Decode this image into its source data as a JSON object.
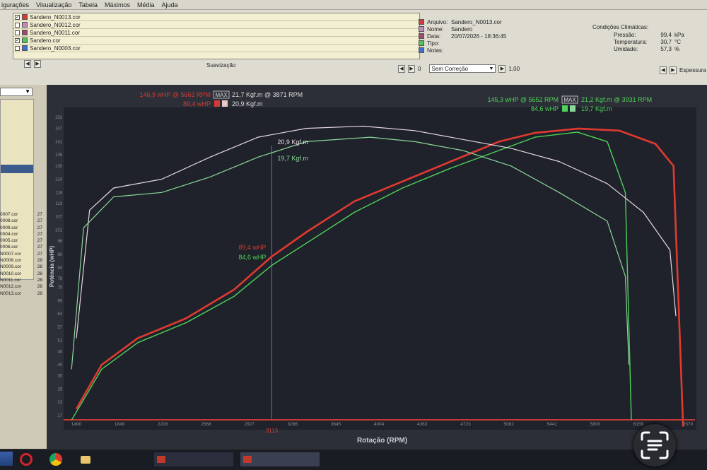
{
  "menu": {
    "items": [
      "igurações",
      "Visualização",
      "Tabela",
      "Máximos",
      "Média",
      "Ajuda"
    ]
  },
  "file_list": [
    {
      "name": "Sandero_N0013.cor",
      "checked": true,
      "color": "#d23a3a"
    },
    {
      "name": "Sandero_N0012.cor",
      "checked": false,
      "color": "#c18bbf"
    },
    {
      "name": "Sandero_N0011.cor",
      "checked": false,
      "color": "#a04a6a"
    },
    {
      "name": "Sandero.cor",
      "checked": true,
      "color": "#4fc25a"
    },
    {
      "name": "Sandero_N0003.cor",
      "checked": false,
      "color": "#3e6fd0"
    }
  ],
  "file_info": [
    {
      "label": "Arquivo:",
      "value": "Sandero_N0013.cor",
      "color": "#d23a3a"
    },
    {
      "label": "Nome:",
      "value": "Sandero",
      "color": "#c18bbf"
    },
    {
      "label": "Data:",
      "value": "20/07/2026 - 18:36:45",
      "color": "#a04a6a"
    },
    {
      "label": "Tipo:",
      "value": "",
      "color": "#4fc25a"
    },
    {
      "label": "Notas:",
      "value": "",
      "color": "#3e6fd0"
    }
  ],
  "climate": {
    "title": "Condições Climáticas:",
    "rows": [
      {
        "label": "Pressão:",
        "value": "99,4",
        "unit": "kPa"
      },
      {
        "label": "Temperatura:",
        "value": "30,7",
        "unit": "°C"
      },
      {
        "label": "Umidade:",
        "value": "57,3",
        "unit": "%"
      }
    ]
  },
  "controls": {
    "smoothing_label": "Suavização",
    "smoothing_value": "0",
    "correction_selected": "Sem Correção",
    "correction_factor": "1,00",
    "thickness_label": "Espessura"
  },
  "sidebar_files": [
    {
      "name": "0007.cor",
      "n": "27"
    },
    {
      "name": "0008.cor",
      "n": "27"
    },
    {
      "name": "0009.cor",
      "n": "27"
    },
    {
      "name": "0004.cor",
      "n": "27"
    },
    {
      "name": "0005.cor",
      "n": "27"
    },
    {
      "name": "0006.cor",
      "n": "27"
    },
    {
      "name": "N0007.cor",
      "n": "27"
    },
    {
      "name": "N0008.cor",
      "n": "28"
    },
    {
      "name": "N0009.cor",
      "n": "28"
    },
    {
      "name": "N0010.cor",
      "n": "28"
    },
    {
      "name": "N0011.cor",
      "n": "28"
    },
    {
      "name": "N0012.cor",
      "n": "28"
    },
    {
      "name": "N0013.cor",
      "n": "28"
    }
  ],
  "readouts": {
    "red_max": "146,9 wHP @ 5662 RPM",
    "red_max_badge": "MAX",
    "red_torque_max": "21,7 Kgf.m @ 3871 RPM",
    "red_cursor_power": "89,4 wHP",
    "red_cursor_torque": "20,9 Kgf.m",
    "green_max": "145,3 wHP @ 5652 RPM",
    "green_max_badge": "MAX",
    "green_torque_max": "21,2 Kgf.m @ 3931 RPM",
    "green_cursor_power": "84,6 wHP",
    "green_cursor_torque": "19,7 Kgf.m",
    "cursor_rpm": "3113"
  },
  "chart_data": {
    "type": "line",
    "xlabel": "Rotação (RPM)",
    "ylabel": "Potência (wHP)",
    "x_ticks": [
      1490,
      1849,
      2208,
      2568,
      2927,
      3286,
      3645,
      4004,
      4363,
      4723,
      5082,
      5441,
      5800,
      6159,
      6570
    ],
    "y_ticks": [
      17,
      23,
      29,
      35,
      40,
      46,
      51,
      57,
      63,
      69,
      75,
      79,
      84,
      90,
      96,
      101,
      107,
      113,
      118,
      124,
      130,
      135,
      141,
      147,
      152
    ],
    "xlim": [
      1490,
      6570
    ],
    "ylim": [
      17,
      152
    ],
    "grid": false,
    "cursor_x": 3113,
    "series": [
      {
        "color": "#e03a30",
        "kind": "power",
        "x": [
          1490,
          1700,
          2000,
          2400,
          2800,
          3113,
          3400,
          3800,
          4200,
          4600,
          5000,
          5300,
          5662,
          6000,
          6300,
          6450,
          6530
        ],
        "y": [
          20,
          40,
          52,
          61,
          74,
          89,
          100,
          114,
          123,
          132,
          141,
          145,
          146.9,
          146,
          140,
          130,
          12
        ]
      },
      {
        "color": "#4fd25a",
        "kind": "power",
        "x": [
          1450,
          1700,
          2000,
          2400,
          2800,
          3113,
          3400,
          3800,
          4200,
          4600,
          5000,
          5300,
          5652,
          5900,
          6050,
          6100
        ],
        "y": [
          15,
          38,
          50,
          59,
          71,
          85,
          95,
          109,
          120,
          129,
          137,
          143,
          145.3,
          141,
          118,
          15
        ]
      },
      {
        "color": "#e8d8e0",
        "kind": "torque",
        "x": [
          1490,
          1600,
          1800,
          2200,
          2600,
          3000,
          3400,
          3871,
          4300,
          4700,
          5100,
          5500,
          5900,
          6200,
          6420,
          6470
        ],
        "y": [
          52,
          110,
          120,
          124,
          134,
          143,
          147,
          148,
          146,
          142,
          138,
          132,
          122,
          109,
          92,
          62
        ]
      },
      {
        "color": "#8ad89a",
        "kind": "torque",
        "x": [
          1450,
          1550,
          1800,
          2200,
          2600,
          3000,
          3400,
          3931,
          4300,
          4700,
          5100,
          5500,
          5900,
          6050,
          6080
        ],
        "y": [
          38,
          102,
          116,
          118,
          125,
          134,
          141,
          143,
          141,
          137,
          130,
          118,
          105,
          80,
          40
        ]
      }
    ]
  }
}
